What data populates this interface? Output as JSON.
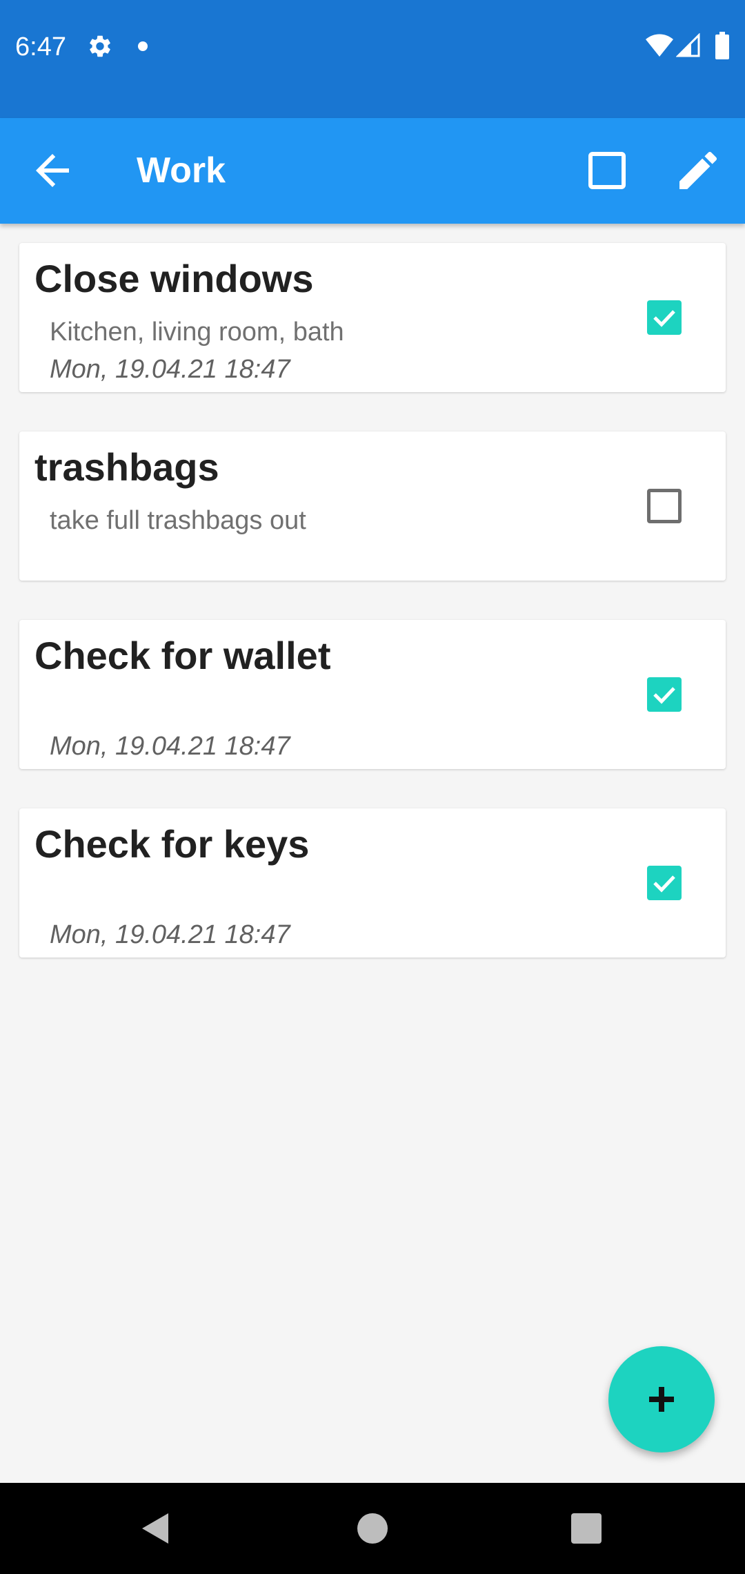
{
  "status_bar": {
    "time": "6:47",
    "icons": [
      "gear-icon",
      "notification-dot-icon",
      "wifi-icon",
      "cell-signal-icon",
      "battery-icon"
    ]
  },
  "app_bar": {
    "title": "Work",
    "icons": [
      "arrow-back-icon",
      "checkbox-outline-icon",
      "pencil-icon"
    ],
    "color": "#2196f3"
  },
  "tasks": [
    {
      "title": "Close windows",
      "description": "Kitchen, living room, bath",
      "date": "Mon, 19.04.21 18:47",
      "checked": true
    },
    {
      "title": "trashbags",
      "description": "take full trashbags out",
      "date": "",
      "checked": false
    },
    {
      "title": "Check for wallet",
      "description": "",
      "date": "Mon, 19.04.21 18:47",
      "checked": true
    },
    {
      "title": "Check for keys",
      "description": "",
      "date": "Mon, 19.04.21 18:47",
      "checked": true
    }
  ],
  "fab": {
    "icon": "plus-icon",
    "color": "#1dd3c0"
  },
  "nav_bar": {
    "icons": [
      "nav-back-icon",
      "nav-home-icon",
      "nav-recents-icon"
    ]
  }
}
